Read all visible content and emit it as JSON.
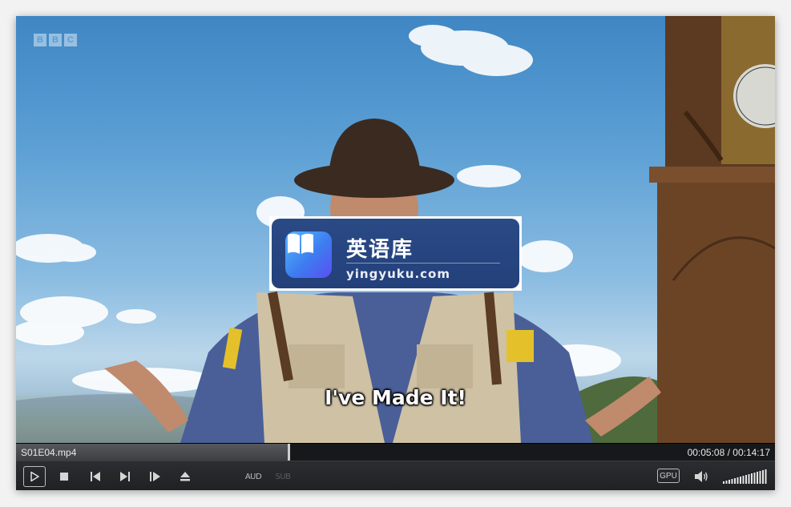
{
  "video": {
    "channel_logo": [
      "B",
      "B",
      "C"
    ],
    "subtitle": "I've Made It!"
  },
  "watermark": {
    "title": "英语库",
    "url": "yingyuku.com",
    "icon": "open-book-icon"
  },
  "seek": {
    "filename": "S01E04.mp4",
    "time_display": "00:05:08 / 00:14:17",
    "progress": 0.3594
  },
  "controls": {
    "play_icon": "play-icon",
    "stop_icon": "stop-icon",
    "prev_icon": "skip-previous-icon",
    "next_icon": "skip-next-icon",
    "frame_step_icon": "frame-step-icon",
    "eject_icon": "eject-icon",
    "audio_label": "AUD",
    "subtitle_label": "SUB",
    "gpu_label": "GPU",
    "volume_icon": "speaker-icon",
    "volume_level": 1.0
  }
}
